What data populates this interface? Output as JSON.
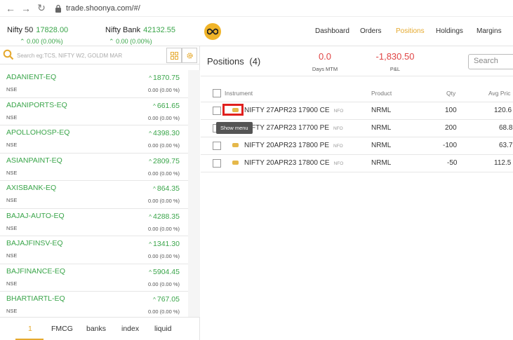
{
  "browser": {
    "url": "trade.shoonya.com/#/"
  },
  "header": {
    "indices": [
      {
        "name": "Nifty 50",
        "value": "17828.00",
        "change": "0.00 (0.00%)"
      },
      {
        "name": "Nifty Bank",
        "value": "42132.55",
        "change": "0.00 (0.00%)"
      }
    ],
    "menu": [
      {
        "label": "Dashboard",
        "active": false
      },
      {
        "label": "Orders",
        "active": false
      },
      {
        "label": "Positions",
        "active": true
      },
      {
        "label": "Holdings",
        "active": false
      },
      {
        "label": "Margins",
        "active": false
      }
    ]
  },
  "watchlist": {
    "search_placeholder": "Search eg:TCS, NIFTY W2, GOLDM MAR",
    "items": [
      {
        "symbol": "ADANIENT-EQ",
        "exchange": "NSE",
        "price": "1870.75",
        "change": "0.00 (0.00 %)"
      },
      {
        "symbol": "ADANIPORTS-EQ",
        "exchange": "NSE",
        "price": "661.65",
        "change": "0.00 (0.00 %)"
      },
      {
        "symbol": "APOLLOHOSP-EQ",
        "exchange": "NSE",
        "price": "4398.30",
        "change": "0.00 (0.00 %)"
      },
      {
        "symbol": "ASIANPAINT-EQ",
        "exchange": "NSE",
        "price": "2809.75",
        "change": "0.00 (0.00 %)"
      },
      {
        "symbol": "AXISBANK-EQ",
        "exchange": "NSE",
        "price": "864.35",
        "change": "0.00 (0.00 %)"
      },
      {
        "symbol": "BAJAJ-AUTO-EQ",
        "exchange": "NSE",
        "price": "4288.35",
        "change": "0.00 (0.00 %)"
      },
      {
        "symbol": "BAJAJFINSV-EQ",
        "exchange": "NSE",
        "price": "1341.30",
        "change": "0.00 (0.00 %)"
      },
      {
        "symbol": "BAJFINANCE-EQ",
        "exchange": "NSE",
        "price": "5904.45",
        "change": "0.00 (0.00 %)"
      },
      {
        "symbol": "BHARTIARTL-EQ",
        "exchange": "NSE",
        "price": "767.05",
        "change": "0.00 (0.00 %)"
      }
    ],
    "tabs": [
      "1",
      "FMCG",
      "banks",
      "index",
      "liquid"
    ]
  },
  "positions": {
    "title": "Positions",
    "count": "(4)",
    "days_mtm": {
      "value": "0.0",
      "label": "Days MTM"
    },
    "pnl": {
      "value": "-1,830.50",
      "label": "P&L"
    },
    "search_placeholder": "Search",
    "columns": {
      "instrument": "Instrument",
      "product": "Product",
      "qty": "Qty",
      "avg": "Avg Pric"
    },
    "tooltip": "Show menu",
    "rows": [
      {
        "instrument": "NIFTY 27APR23 17900 CE",
        "exchange": "NFO",
        "product": "NRML",
        "qty": "100",
        "avg": "120.6"
      },
      {
        "instrument": "NIFTY 27APR23 17700 PE",
        "exchange": "NFO",
        "product": "NRML",
        "qty": "200",
        "avg": "68.8"
      },
      {
        "instrument": "NIFTY 20APR23 17800 PE",
        "exchange": "NFO",
        "product": "NRML",
        "qty": "-100",
        "avg": "63.7"
      },
      {
        "instrument": "NIFTY 20APR23 17800 CE",
        "exchange": "NFO",
        "product": "NRML",
        "qty": "-50",
        "avg": "112.5"
      }
    ]
  }
}
